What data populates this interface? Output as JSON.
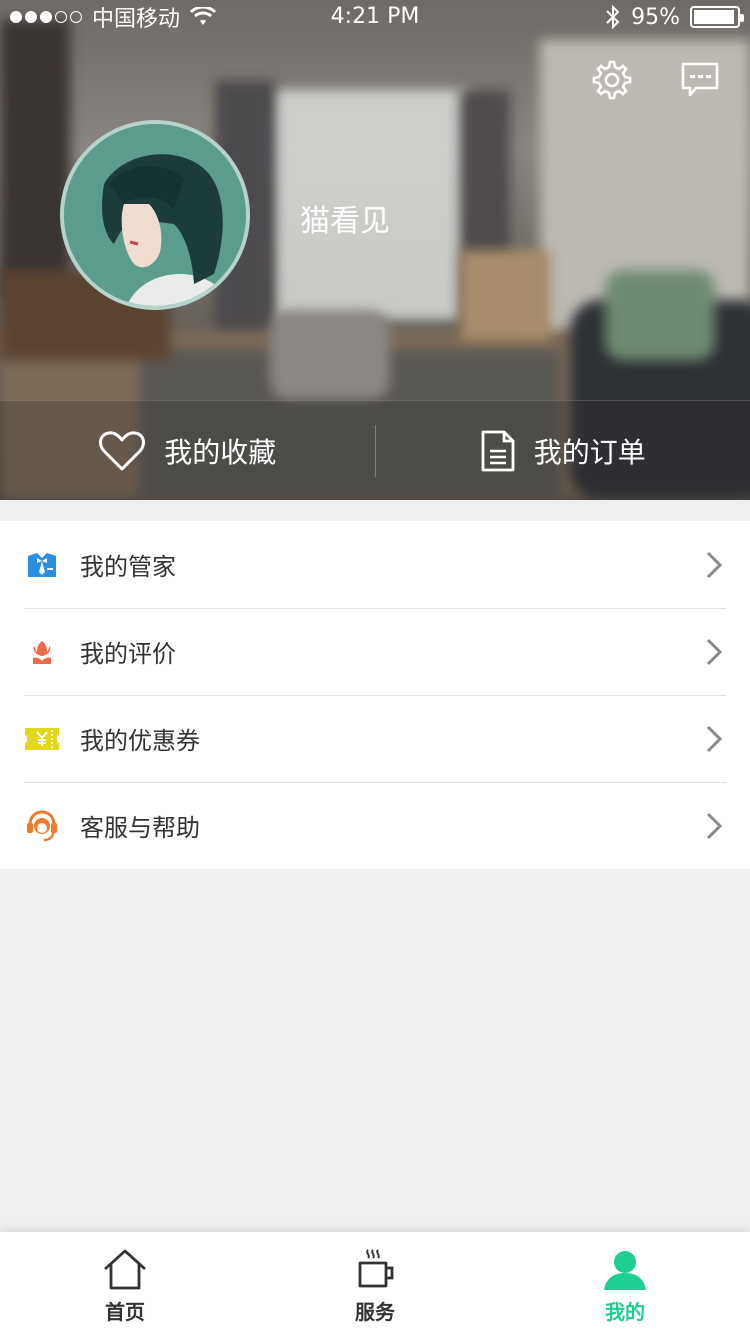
{
  "status_bar": {
    "carrier": "中国移动",
    "time": "4:21 PM",
    "battery": "95%"
  },
  "profile": {
    "username": "猫看见"
  },
  "quick_actions": [
    {
      "label": "我的收藏",
      "icon": "heart-icon"
    },
    {
      "label": "我的订单",
      "icon": "document-icon"
    }
  ],
  "menu": [
    {
      "label": "我的管家",
      "icon": "butler-icon",
      "color": "#2b8fe0"
    },
    {
      "label": "我的评价",
      "icon": "tulip-icon",
      "color": "#f06a4c"
    },
    {
      "label": "我的优惠券",
      "icon": "coupon-icon",
      "color": "#e3d71a"
    },
    {
      "label": "客服与帮助",
      "icon": "headset-icon",
      "color": "#f07a2a"
    }
  ],
  "tabs": [
    {
      "label": "首页",
      "icon": "home-icon"
    },
    {
      "label": "服务",
      "icon": "coffee-icon"
    },
    {
      "label": "我的",
      "icon": "user-icon",
      "active": true
    }
  ],
  "colors": {
    "accent": "#1fce93"
  }
}
